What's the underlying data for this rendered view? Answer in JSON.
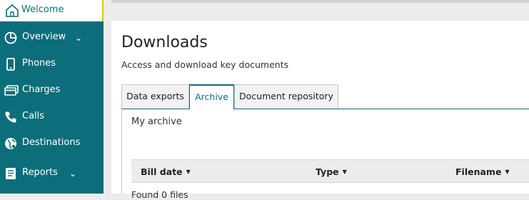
{
  "sidebar": {
    "items": [
      {
        "label": "Welcome",
        "icon": "home-icon"
      },
      {
        "label": "Overview",
        "icon": "pie-chart-icon",
        "expandable": true
      },
      {
        "label": "Phones",
        "icon": "phone-device-icon"
      },
      {
        "label": "Charges",
        "icon": "credit-card-icon"
      },
      {
        "label": "Calls",
        "icon": "phone-handset-icon"
      },
      {
        "label": "Destinations",
        "icon": "globe-icon"
      },
      {
        "label": "Reports",
        "icon": "report-icon",
        "expandable": true
      }
    ],
    "active_item": "Welcome",
    "background_color": "#0b6e7a",
    "active_indicator_color": "#e6c200"
  },
  "page": {
    "title": "Downloads",
    "subtitle": "Access and download key documents"
  },
  "tabs": [
    {
      "label": "Data exports"
    },
    {
      "label": "Archive"
    },
    {
      "label": "Document repository"
    }
  ],
  "active_tab": "Archive",
  "archive": {
    "heading": "My archive",
    "columns": [
      "Bill date",
      "Type",
      "Filename"
    ],
    "sort_icon": "caret-down-icon",
    "footer_text": "Found 0 files"
  },
  "colors": {
    "accent": "#0b6e7a",
    "header_bg": "#ececec"
  }
}
